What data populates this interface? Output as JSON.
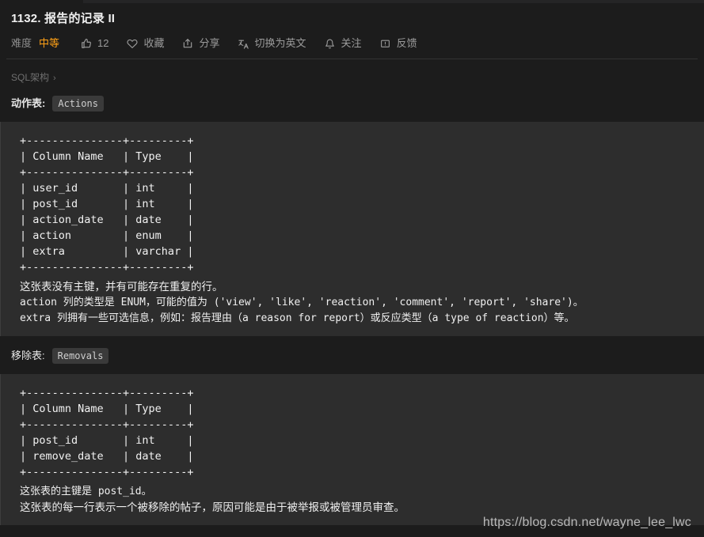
{
  "header": {
    "title": "1132. 报告的记录 II",
    "meta": {
      "difficulty_label": "难度",
      "difficulty_value": "中等",
      "difficulty_color": "#ffa116",
      "likes_count": "12",
      "favorite_label": "收藏",
      "share_label": "分享",
      "translate_label": "切换为英文",
      "follow_label": "关注",
      "feedback_label": "反馈",
      "icons": {
        "like": "thumbs-up-icon",
        "favorite": "heart-icon",
        "share": "share-icon",
        "translate": "translate-icon",
        "follow": "bell-icon",
        "feedback": "feedback-icon"
      }
    }
  },
  "breadcrumb": {
    "label": "SQL架构",
    "chevron": "›"
  },
  "sections": [
    {
      "heading_label": "动作表:",
      "table_name": "Actions",
      "ascii_table": "+---------------+---------+\n| Column Name   | Type    |\n+---------------+---------+\n| user_id       | int     |\n| post_id       | int     |\n| action_date   | date    |\n| action        | enum    |\n| extra         | varchar |\n+---------------+---------+",
      "notes": [
        "这张表没有主键，并有可能存在重复的行。",
        "action 列的类型是 ENUM，可能的值为 ('view', 'like', 'reaction', 'comment', 'report', 'share')。",
        "extra 列拥有一些可选信息，例如：报告理由（a reason for report）或反应类型（a type of reaction）等。"
      ]
    },
    {
      "heading_label": "移除表:",
      "table_name": "Removals",
      "ascii_table": "+---------------+---------+\n| Column Name   | Type    |\n+---------------+---------+\n| post_id       | int     |\n| remove_date   | date    |\n+---------------+---------+",
      "notes": [
        "这张表的主键是 post_id。",
        "这张表的每一行表示一个被移除的帖子，原因可能是由于被举报或被管理员审查。"
      ]
    }
  ],
  "watermark": "https://blog.csdn.net/wayne_lee_lwc",
  "colors": {
    "page_bg": "#1c1c1c",
    "code_bg": "#2d2d2d",
    "accent_orange": "#ffa116",
    "muted_text": "#9b9b9b"
  }
}
